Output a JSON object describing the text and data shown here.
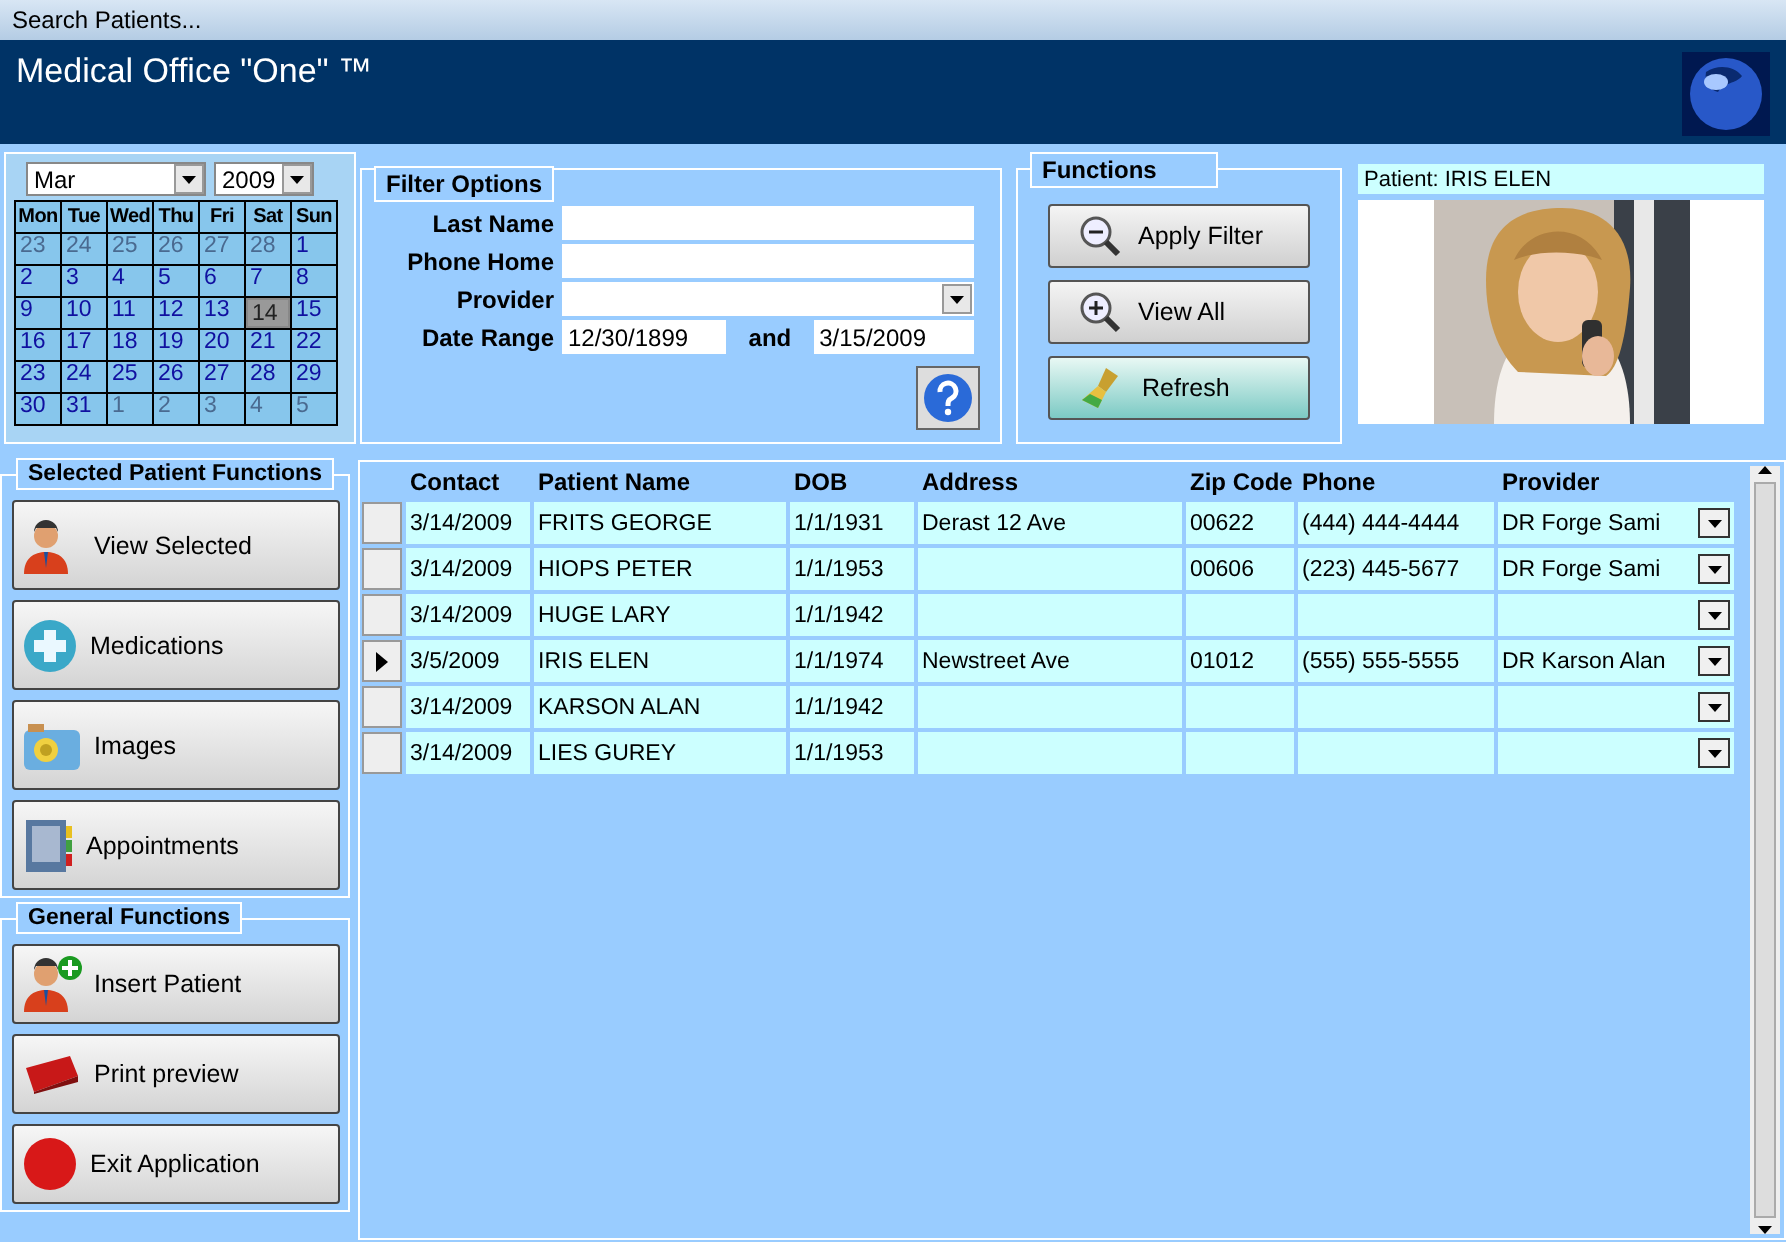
{
  "window": {
    "title": "Search Patients..."
  },
  "header": {
    "title": "Medical Office \"One\" ™"
  },
  "calendar": {
    "month": "Mar",
    "year": "2009",
    "weekdays": [
      "Mon",
      "Tue",
      "Wed",
      "Thu",
      "Fri",
      "Sat",
      "Sun"
    ],
    "days": [
      {
        "label": "23",
        "in_month": false,
        "selected": false
      },
      {
        "label": "24",
        "in_month": false,
        "selected": false
      },
      {
        "label": "25",
        "in_month": false,
        "selected": false
      },
      {
        "label": "26",
        "in_month": false,
        "selected": false
      },
      {
        "label": "27",
        "in_month": false,
        "selected": false
      },
      {
        "label": "28",
        "in_month": false,
        "selected": false
      },
      {
        "label": "1",
        "in_month": true,
        "selected": false
      },
      {
        "label": "2",
        "in_month": true,
        "selected": false
      },
      {
        "label": "3",
        "in_month": true,
        "selected": false
      },
      {
        "label": "4",
        "in_month": true,
        "selected": false
      },
      {
        "label": "5",
        "in_month": true,
        "selected": false
      },
      {
        "label": "6",
        "in_month": true,
        "selected": false
      },
      {
        "label": "7",
        "in_month": true,
        "selected": false
      },
      {
        "label": "8",
        "in_month": true,
        "selected": false
      },
      {
        "label": "9",
        "in_month": true,
        "selected": false
      },
      {
        "label": "10",
        "in_month": true,
        "selected": false
      },
      {
        "label": "11",
        "in_month": true,
        "selected": false
      },
      {
        "label": "12",
        "in_month": true,
        "selected": false
      },
      {
        "label": "13",
        "in_month": true,
        "selected": false
      },
      {
        "label": "14",
        "in_month": true,
        "selected": true
      },
      {
        "label": "15",
        "in_month": true,
        "selected": false
      },
      {
        "label": "16",
        "in_month": true,
        "selected": false
      },
      {
        "label": "17",
        "in_month": true,
        "selected": false
      },
      {
        "label": "18",
        "in_month": true,
        "selected": false
      },
      {
        "label": "19",
        "in_month": true,
        "selected": false
      },
      {
        "label": "20",
        "in_month": true,
        "selected": false
      },
      {
        "label": "21",
        "in_month": true,
        "selected": false
      },
      {
        "label": "22",
        "in_month": true,
        "selected": false
      },
      {
        "label": "23",
        "in_month": true,
        "selected": false
      },
      {
        "label": "24",
        "in_month": true,
        "selected": false
      },
      {
        "label": "25",
        "in_month": true,
        "selected": false
      },
      {
        "label": "26",
        "in_month": true,
        "selected": false
      },
      {
        "label": "27",
        "in_month": true,
        "selected": false
      },
      {
        "label": "28",
        "in_month": true,
        "selected": false
      },
      {
        "label": "29",
        "in_month": true,
        "selected": false
      },
      {
        "label": "30",
        "in_month": true,
        "selected": false
      },
      {
        "label": "31",
        "in_month": true,
        "selected": false
      },
      {
        "label": "1",
        "in_month": false,
        "selected": false
      },
      {
        "label": "2",
        "in_month": false,
        "selected": false
      },
      {
        "label": "3",
        "in_month": false,
        "selected": false
      },
      {
        "label": "4",
        "in_month": false,
        "selected": false
      },
      {
        "label": "5",
        "in_month": false,
        "selected": false
      }
    ]
  },
  "filter_options": {
    "title": "Filter Options",
    "last_name": {
      "label": "Last Name"
    },
    "phone_home": {
      "label": "Phone Home"
    },
    "provider": {
      "label": "Provider"
    },
    "date_range": {
      "label": "Date Range",
      "from": "12/30/1899",
      "joiner": "and",
      "to": "3/15/2009"
    }
  },
  "functions": {
    "title": "Functions",
    "buttons": [
      {
        "label": "Apply Filter",
        "kind": "zoom_out"
      },
      {
        "label": "View All",
        "kind": "zoom_in"
      },
      {
        "label": "Refresh",
        "kind": "broom"
      }
    ]
  },
  "patient": {
    "label": "Patient: IRIS ELEN"
  },
  "selected_patient_functions": {
    "title": "Selected Patient Functions",
    "buttons": [
      {
        "label": "View Selected",
        "kind": "person"
      },
      {
        "label": "Medications",
        "kind": "cross"
      },
      {
        "label": "Images",
        "kind": "camera"
      },
      {
        "label": "Appointments",
        "kind": "book"
      }
    ]
  },
  "general_functions": {
    "title": "General Functions",
    "buttons": [
      {
        "label": "Insert Patient",
        "kind": "person_add"
      },
      {
        "label": "Print preview",
        "kind": "print"
      },
      {
        "label": "Exit Application",
        "kind": "stop"
      }
    ]
  },
  "table": {
    "columns": [
      "Contact",
      "Patient Name",
      "DOB",
      "Address",
      "Zip Code",
      "Phone",
      "Provider"
    ],
    "rows": [
      {
        "current": false,
        "cells": [
          "3/14/2009",
          "FRITS GEORGE",
          "1/1/1931",
          "Derast 12 Ave",
          "00622",
          "(444) 444-4444",
          "DR Forge Sami"
        ]
      },
      {
        "current": false,
        "cells": [
          "3/14/2009",
          "HIOPS PETER",
          "1/1/1953",
          "",
          "00606",
          "(223) 445-5677",
          "DR Forge Sami"
        ]
      },
      {
        "current": false,
        "cells": [
          "3/14/2009",
          "HUGE LARY",
          "1/1/1942",
          "",
          "",
          "",
          ""
        ]
      },
      {
        "current": true,
        "cells": [
          "3/5/2009",
          "IRIS ELEN",
          "1/1/1974",
          "Newstreet Ave",
          "01012",
          "(555) 555-5555",
          "DR Karson Alan"
        ]
      },
      {
        "current": false,
        "cells": [
          "3/14/2009",
          "KARSON ALAN",
          "1/1/1942",
          "",
          "",
          "",
          ""
        ]
      },
      {
        "current": false,
        "cells": [
          "3/14/2009",
          "LIES GUREY",
          "1/1/1953",
          "",
          "",
          "",
          ""
        ]
      }
    ]
  }
}
